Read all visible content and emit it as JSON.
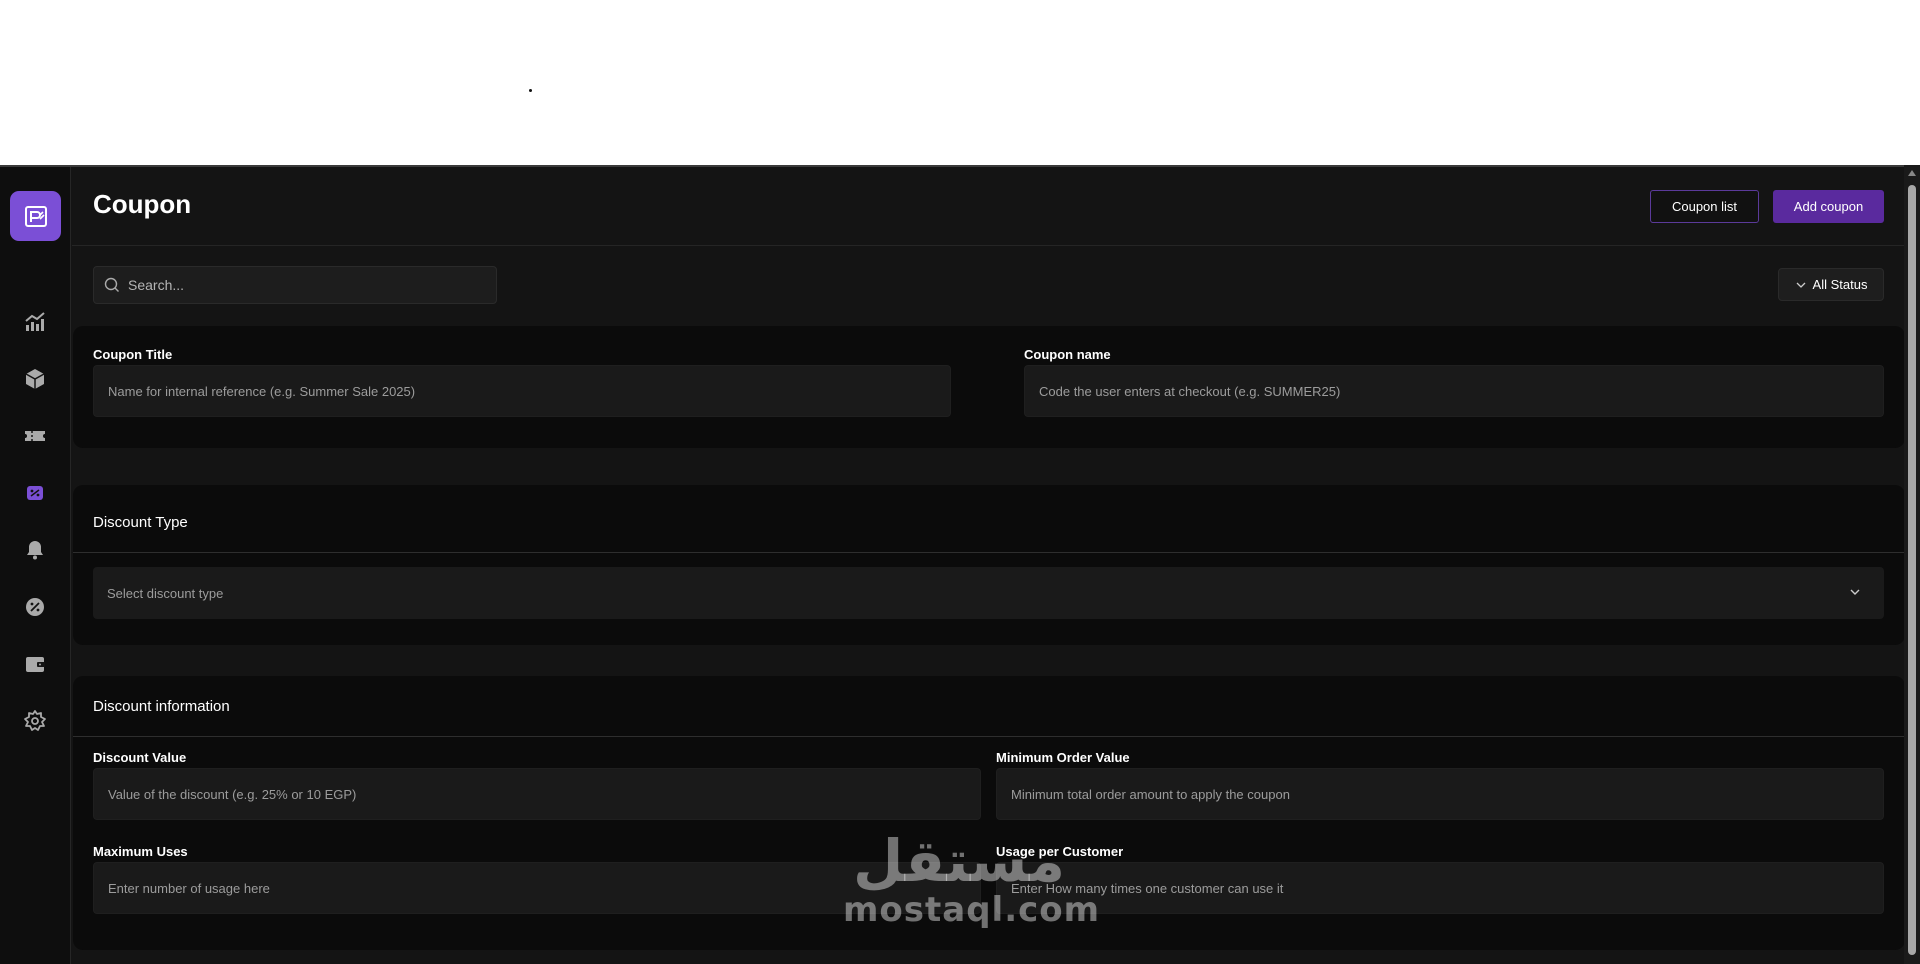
{
  "page": {
    "title": "Coupon"
  },
  "header": {
    "coupon_list_label": "Coupon list",
    "add_coupon_label": "Add coupon"
  },
  "filters": {
    "search_placeholder": "Search...",
    "status_label": "All Status"
  },
  "sidebar": {
    "logo_icon": "brand-logo-icon",
    "items": [
      {
        "icon": "analytics-chart-icon",
        "active": false
      },
      {
        "icon": "package-box-icon",
        "active": false
      },
      {
        "icon": "ticket-icon",
        "active": false
      },
      {
        "icon": "coupon-icon",
        "active": true
      },
      {
        "icon": "bell-icon",
        "active": false
      },
      {
        "icon": "discount-badge-icon",
        "active": false
      },
      {
        "icon": "wallet-icon",
        "active": false
      },
      {
        "icon": "settings-gear-icon",
        "active": false
      }
    ]
  },
  "coupon_basic": {
    "title_label": "Coupon Title",
    "title_placeholder": "Name for internal reference (e.g. Summer Sale 2025)",
    "name_label": "Coupon name",
    "name_placeholder": "Code the user enters at checkout (e.g. SUMMER25)"
  },
  "discount_type": {
    "heading": "Discount Type",
    "select_placeholder": "Select discount type"
  },
  "discount_info": {
    "heading": "Discount information",
    "value_label": "Discount Value",
    "value_placeholder": "Value of the discount (e.g. 25% or 10 EGP)",
    "min_order_label": "Minimum Order Value",
    "min_order_placeholder": "Minimum total order amount to apply the coupon",
    "max_uses_label": "Maximum Uses",
    "max_uses_placeholder": "Enter number of usage here",
    "per_customer_label": "Usage per Customer",
    "per_customer_placeholder": "Enter How many times one customer can use it"
  },
  "watermark": {
    "arabic": "مستقل",
    "latin": "mostaql.com"
  },
  "colors": {
    "accent": "#5a2a9e",
    "logo_bg": "#7b4fd6",
    "active_icon": "#7b4fd6",
    "background": "#141414",
    "card": "#0b0b0b"
  }
}
